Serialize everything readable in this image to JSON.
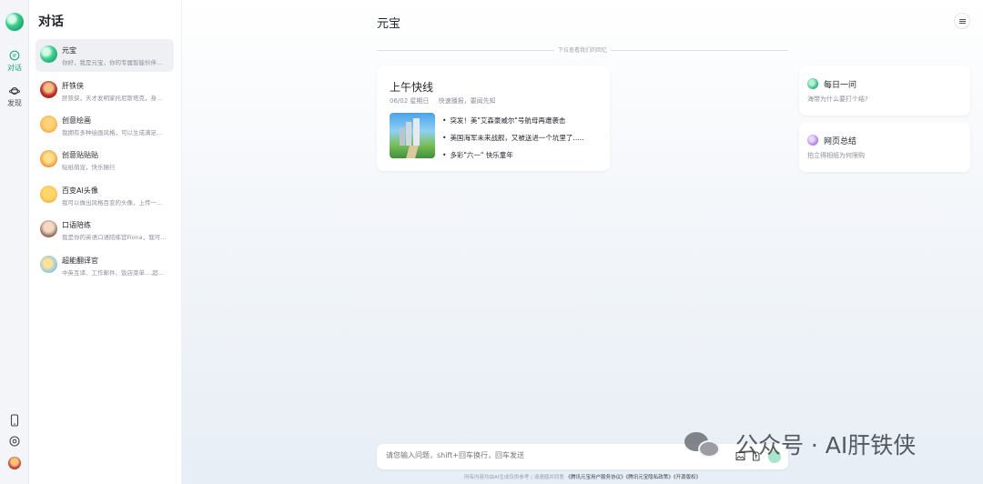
{
  "rail": {
    "chat_label": "对话",
    "discover_label": "发现"
  },
  "list": {
    "title": "对话",
    "items": [
      {
        "name": "元宝",
        "preview": "你好，我是元宝，你的专属智能伙伴..."
      },
      {
        "name": "肝铁侠",
        "preview": "肝铁侠，天才发明家托尼斯塔克，身..."
      },
      {
        "name": "创意绘画",
        "preview": "我拥有多种绘画风格，可以生成满足..."
      },
      {
        "name": "创意贴贴贴",
        "preview": "贴纸萌宠，快乐随行"
      },
      {
        "name": "百变AI头像",
        "preview": "我可以做出风格百变的头像，上传一..."
      },
      {
        "name": "口语陪练",
        "preview": "我是你的英语口语陪练官Fiona，我可..."
      },
      {
        "name": "超能翻译官",
        "preview": "中英互译、工作邮件、饭店菜单....超..."
      }
    ]
  },
  "main": {
    "title": "元宝",
    "history_hint": "下拉查看我们的回忆",
    "news": {
      "title": "上午快线",
      "date": "06/02 星期日",
      "tagline": "快速播报，要闻先知",
      "bullets": [
        "突发！美\"艾森豪威尔\"号航母再遭袭击",
        "美国海军未来战舰，又被送进一个坑里了.....",
        "多彩\"六一\" 快乐童年"
      ]
    },
    "daily": {
      "title": "每日一问",
      "subtitle": "海带为什么要打个结?"
    },
    "summary": {
      "title": "网页总结",
      "subtitle": "拍立得相纸为何限购"
    },
    "input": {
      "placeholder": "请您输入问题，shift+回车换行，回车发送"
    },
    "footer": {
      "prefix": "所有内容均由AI生成仅供参考 | 请遵循并同意",
      "link1": "《腾讯元宝用户服务协议》",
      "link2": "《腾讯元宝隐私政策》",
      "link3": "《开源版权》"
    }
  },
  "watermark": {
    "text": "公众号 · AI肝铁侠"
  },
  "colors": {
    "accent": "#17a673",
    "background": "#eef2f6"
  }
}
